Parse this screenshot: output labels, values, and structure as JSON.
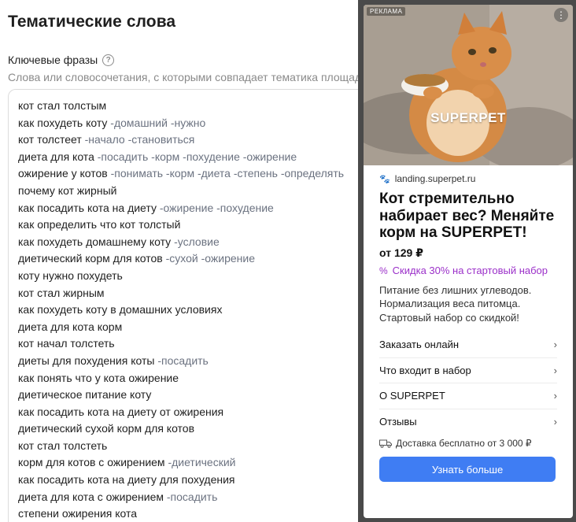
{
  "page": {
    "title": "Тематические слова",
    "field_label": "Ключевые фразы",
    "field_hint": "Слова или словосочетания, с которыми совпадает тематика площадки"
  },
  "phrases": [
    {
      "main": "кот стал толстым",
      "minus": ""
    },
    {
      "main": "как похудеть коту",
      "minus": "-домашний -нужно"
    },
    {
      "main": "кот толстеет",
      "minus": "-начало -становиться"
    },
    {
      "main": "диета для кота",
      "minus": "-посадить -корм -похудение -ожирение"
    },
    {
      "main": "ожирение у котов",
      "minus": "-понимать -корм -диета -степень -определять"
    },
    {
      "main": "почему кот жирный",
      "minus": ""
    },
    {
      "main": "как посадить кота на диету",
      "minus": "-ожирение -похудение"
    },
    {
      "main": "как определить что кот толстый",
      "minus": ""
    },
    {
      "main": "как похудеть домашнему коту",
      "minus": "-условие"
    },
    {
      "main": "диетический корм для котов",
      "minus": "-сухой -ожирение"
    },
    {
      "main": "коту нужно похудеть",
      "minus": ""
    },
    {
      "main": "кот стал жирным",
      "minus": ""
    },
    {
      "main": "как похудеть коту в домашних условиях",
      "minus": ""
    },
    {
      "main": "диета для кота корм",
      "minus": ""
    },
    {
      "main": "кот начал толстеть",
      "minus": ""
    },
    {
      "main": "диеты для похудения коты",
      "minus": "-посадить"
    },
    {
      "main": "как понять что у кота ожирение",
      "minus": ""
    },
    {
      "main": "диетическое питание коту",
      "minus": ""
    },
    {
      "main": "как посадить кота на диету от ожирения",
      "minus": ""
    },
    {
      "main": "диетический сухой корм для котов",
      "minus": ""
    },
    {
      "main": "кот стал толстеть",
      "minus": ""
    },
    {
      "main": "корм для котов с ожирением",
      "minus": "-диетический"
    },
    {
      "main": "как посадить кота на диету для похудения",
      "minus": ""
    },
    {
      "main": "диета для кота с ожирением",
      "minus": "-посадить"
    },
    {
      "main": "степени ожирения кота",
      "minus": ""
    }
  ],
  "ad": {
    "label": "РЕКЛАМА",
    "brand_overlay": "SUPERPET",
    "domain": "landing.superpet.ru",
    "headline": "Кот стремительно набирает вес? Меняйте корм на SUPERPET!",
    "price": "от 129 ₽",
    "discount": "Скидка 30% на стартовый набор",
    "description": "Питание без лишних углеводов. Нормализация веса питомца. Стартовый набор со скидкой!",
    "links": [
      "Заказать онлайн",
      "Что входит в набор",
      "О SUPERPET",
      "Отзывы"
    ],
    "delivery": "Доставка бесплатно от 3 000 ₽",
    "cta": "Узнать больше"
  },
  "colors": {
    "minus_words": "#6b7280",
    "discount": "#9b30c9",
    "cta_bg": "#3f7df3",
    "ad_frame": "#4a4a4a"
  },
  "icons": {
    "help": "question-circle-icon",
    "more": "more-vertical-icon",
    "paw": "paw-icon",
    "discount": "percent-icon",
    "chevron": "chevron-right-icon",
    "delivery": "truck-icon"
  }
}
